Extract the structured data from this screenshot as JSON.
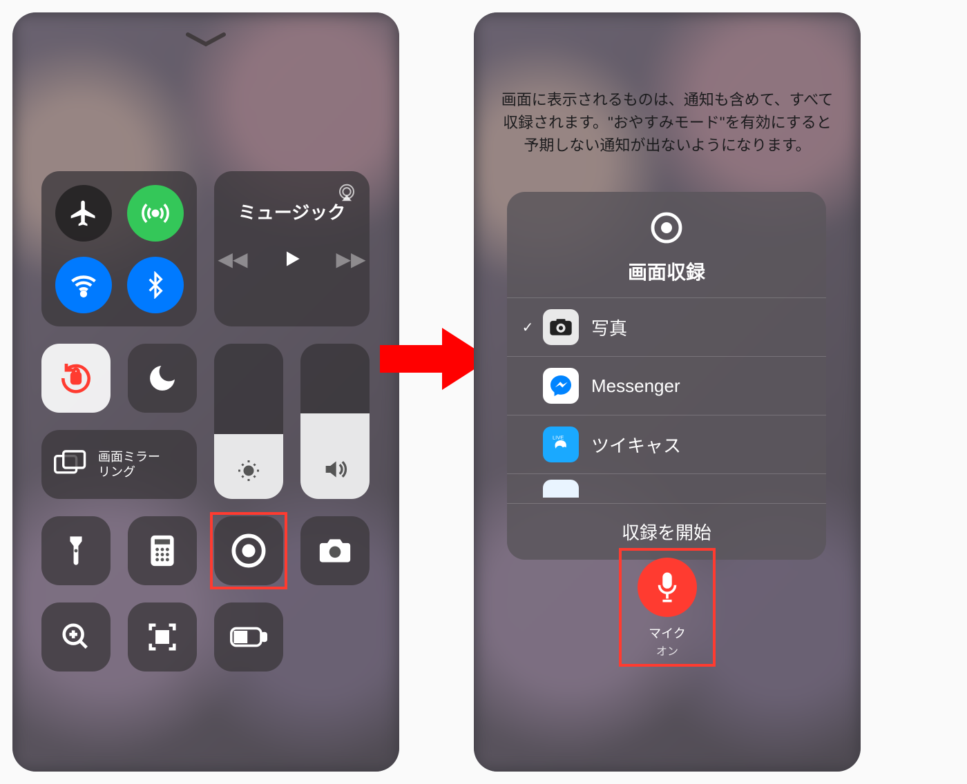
{
  "left": {
    "music_label": "ミュージック",
    "screen_mirroring": "画面ミラー\nリング"
  },
  "right": {
    "notice": "画面に表示されるものは、通知も含めて、すべて収録されます。\"おやすみモード\"を有効にすると予期しない通知が出ないようになります。",
    "title": "画面収録",
    "apps": [
      {
        "label": "写真",
        "icon": "photos-icon",
        "checked": true
      },
      {
        "label": "Messenger",
        "icon": "messenger-icon",
        "checked": false
      },
      {
        "label": "ツイキャス",
        "icon": "twitcasting-icon",
        "checked": false
      }
    ],
    "start": "収録を開始",
    "mic_label": "マイク",
    "mic_state": "オン"
  }
}
